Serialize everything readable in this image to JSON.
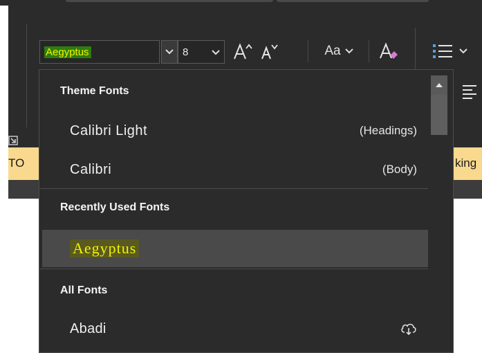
{
  "font_name_box": {
    "value": "Aegyptus"
  },
  "font_size_box": {
    "value": "8"
  },
  "toolbar": {
    "change_case_label": "Aa"
  },
  "background_text": {
    "left_fragment": "TO",
    "right_fragment": "king"
  },
  "font_menu": {
    "sections": {
      "theme_fonts": "Theme Fonts",
      "recent": "Recently Used Fonts",
      "all": "All Fonts"
    },
    "theme_fonts": [
      {
        "name": "Calibri Light",
        "tag": "(Headings)"
      },
      {
        "name": "Calibri",
        "tag": "(Body)"
      }
    ],
    "recent_fonts": [
      {
        "name": "Aegyptus"
      }
    ],
    "all_fonts": [
      {
        "name": "Abadi",
        "icon": "cloud-download-icon"
      }
    ]
  },
  "colors": {
    "ribbon_bg": "#2b2b2b",
    "menu_bg": "#2b2b2b",
    "highlight_text": "#f2f200",
    "highlight_bg_green": "#2e7d0f",
    "banner_yellow": "#f9d98e",
    "clear_format_accent": "#d67bd6",
    "list_accent": "#5aa0e0"
  }
}
